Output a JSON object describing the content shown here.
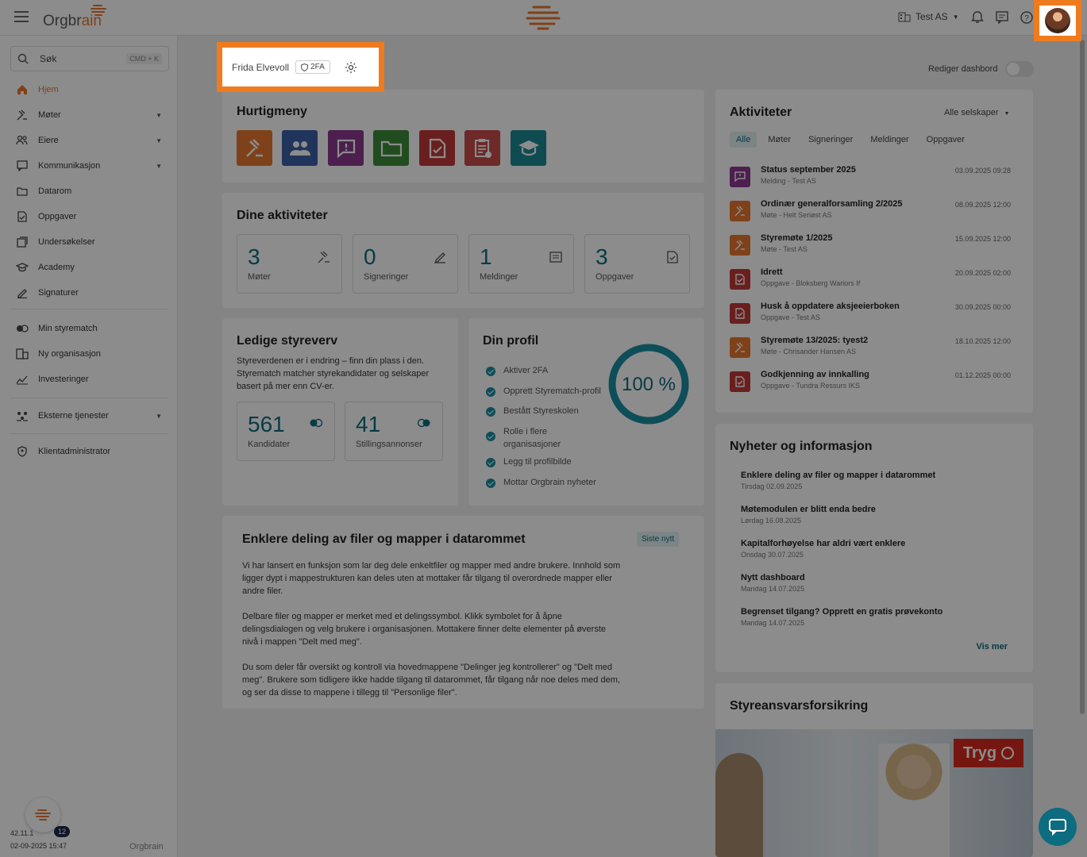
{
  "topbar": {
    "logo_prefix": "Orgbr",
    "logo_suffix": "ain",
    "company": "Test AS"
  },
  "sidebar": {
    "search_label": "Søk",
    "search_shortcut": "CMD + K",
    "items": [
      {
        "label": "Hjem",
        "icon": "home-icon"
      },
      {
        "label": "Møter",
        "icon": "gavel-icon"
      },
      {
        "label": "Eiere",
        "icon": "people-icon"
      },
      {
        "label": "Kommunikasjon",
        "icon": "message-icon"
      },
      {
        "label": "Datarom",
        "icon": "folder-icon"
      },
      {
        "label": "Oppgaver",
        "icon": "task-icon"
      },
      {
        "label": "Undersøkelser",
        "icon": "survey-icon"
      },
      {
        "label": "Academy",
        "icon": "academy-icon"
      },
      {
        "label": "Signaturer",
        "icon": "pen-icon"
      },
      {
        "label": "Min styrematch",
        "icon": "match-icon"
      },
      {
        "label": "Ny organisasjon",
        "icon": "building-icon"
      },
      {
        "label": "Investeringer",
        "icon": "chart-icon"
      },
      {
        "label": "Eksterne tjenester",
        "icon": "services-icon"
      },
      {
        "label": "Klientadministrator",
        "icon": "shield-icon"
      }
    ],
    "notif_count": "12",
    "version": "42.11.1",
    "timestamp": "02-09-2025 15:47",
    "footer_logo": "Orgbrain"
  },
  "user": {
    "name": "Frida Elvevoll",
    "tfa": "2FA"
  },
  "dashboard": {
    "edit_label": "Rediger dashbord"
  },
  "quickmenu": {
    "title": "Hurtigmeny",
    "colors": [
      "#e8772e",
      "#3b5fa8",
      "#8a3a8e",
      "#3d8a3a",
      "#c23a3a",
      "#c94c4c",
      "#1c8a95"
    ]
  },
  "activities_summary": {
    "title": "Dine aktiviteter",
    "items": [
      {
        "value": "3",
        "label": "Møter"
      },
      {
        "value": "0",
        "label": "Signeringer"
      },
      {
        "value": "1",
        "label": "Meldinger"
      },
      {
        "value": "3",
        "label": "Oppgaver"
      }
    ]
  },
  "vacancies": {
    "title": "Ledige styreverv",
    "text": "Styreverdenen er i endring – finn din plass i den. Styrematch matcher styrekandidater og selskaper basert på mer enn CV-er.",
    "candidates_value": "561",
    "candidates_label": "Kandidater",
    "ads_value": "41",
    "ads_label": "Stillingsannonser"
  },
  "profile": {
    "title": "Din profil",
    "progress_label": "100 %",
    "progress": 1.0,
    "items": [
      "Aktiver 2FA",
      "Opprett Styrematch-profil",
      "Bestått Styreskolen",
      "Rolle i flere organisasjoner",
      "Legg til profilbilde",
      "Mottar Orgbrain nyheter"
    ]
  },
  "article": {
    "title": "Enklere deling av filer og mapper i datarommet",
    "badge": "Siste nytt",
    "p1": "Vi har lansert en funksjon som lar deg dele enkeltfiler og mapper med andre brukere. Innhold som ligger dypt i mappestrukturen kan deles uten at mottaker får tilgang til overordnede mapper eller andre filer.",
    "p2": "Delbare filer og mapper er merket med et delingssymbol. Klikk symbolet for å åpne delingsdialogen og velg brukere i organisasjonen. Mottakere finner delte elementer på øverste nivå i mappen \"Delt med meg\".",
    "p3": "Du som deler får oversikt og kontroll via hovedmappene \"Delinger jeg kontrollerer\" og \"Delt med meg\". Brukere som tidligere ikke hadde tilgang til datarommet, får tilgang når noe deles med dem, og ser da disse to mappene i tillegg til \"Personlige filer\"."
  },
  "activities": {
    "title": "Aktiviteter",
    "filter": "Alle selskaper",
    "tabs": [
      "Alle",
      "Møter",
      "Signeringer",
      "Meldinger",
      "Oppgaver"
    ],
    "rows": [
      {
        "title": "Status september 2025",
        "sub": "Melding - Test AS",
        "date": "03.09.2025 09:28",
        "type": "message"
      },
      {
        "title": "Ordinær generalforsamling 2/2025",
        "sub": "Møte - Helt Seriøst AS",
        "date": "08.09.2025 12:00",
        "type": "meeting"
      },
      {
        "title": "Styremøte 1/2025",
        "sub": "Møte - Test AS",
        "date": "15.09.2025 12:00",
        "type": "meeting"
      },
      {
        "title": "Idrett",
        "sub": "Oppgave - Bloksberg Wariors If",
        "date": "20.09.2025 02:00",
        "type": "task"
      },
      {
        "title": "Husk å oppdatere aksjeeierboken",
        "sub": "Oppgave - Test AS",
        "date": "30.09.2025 00:00",
        "type": "task"
      },
      {
        "title": "Styremøte 13/2025: tyest2",
        "sub": "Møte - Chrisander Hansen AS",
        "date": "18.10.2025 12:00",
        "type": "meeting"
      },
      {
        "title": "Godkjenning av innkalling",
        "sub": "Oppgave - Tundra Ressurs IKS",
        "date": "01.12.2025 00:00",
        "type": "task"
      }
    ]
  },
  "news": {
    "title": "Nyheter og informasjon",
    "more": "Vis mer",
    "items": [
      {
        "title": "Enklere deling av filer og mapper i datarommet",
        "date": "Tirsdag 02.09.2025"
      },
      {
        "title": "Møtemodulen er blitt enda bedre",
        "date": "Lørdag 16.08.2025"
      },
      {
        "title": "Kapitalforhøyelse har aldri vært enklere",
        "date": "Onsdag 30.07.2025"
      },
      {
        "title": "Nytt dashboard",
        "date": "Mandag 14.07.2025"
      },
      {
        "title": "Begrenset tilgang? Opprett en gratis prøvekonto",
        "date": "Mandag 14.07.2025"
      }
    ]
  },
  "insurance": {
    "title": "Styreansvarsforsikring",
    "brand": "Tryg"
  }
}
